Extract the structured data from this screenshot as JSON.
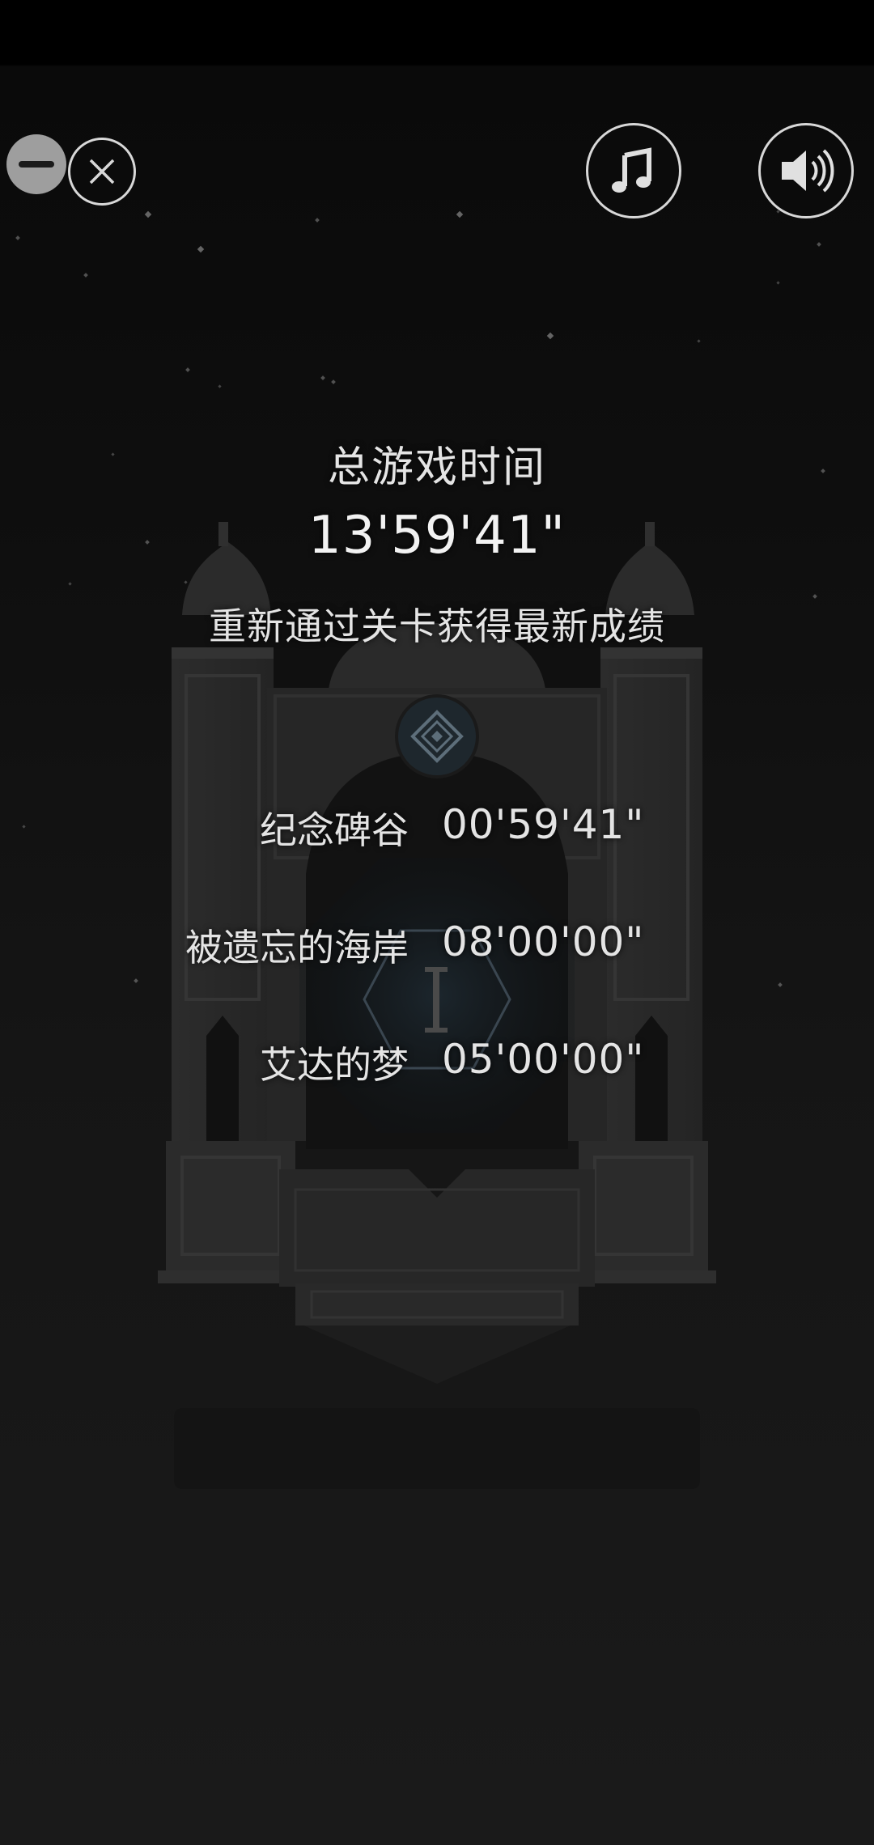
{
  "controls": {
    "minimize_icon": "minus-circle-icon",
    "close_icon": "close-x-icon",
    "music_icon": "music-note-icon",
    "sound_icon": "speaker-icon"
  },
  "summary": {
    "label": "总游戏时间",
    "total_time": "13'59'41\"",
    "hint": "重新通过关卡获得最新成绩"
  },
  "levels": [
    {
      "name": "纪念碑谷",
      "time": "00'59'41\""
    },
    {
      "name": "被遗忘的海岸",
      "time": "08'00'00\""
    },
    {
      "name": "艾达的梦",
      "time": "05'00'00\""
    }
  ],
  "colors": {
    "background": "#000000",
    "monument": "#2a2a2a",
    "text": "#e4e4e4",
    "accent_gem": "#4a5a66"
  }
}
